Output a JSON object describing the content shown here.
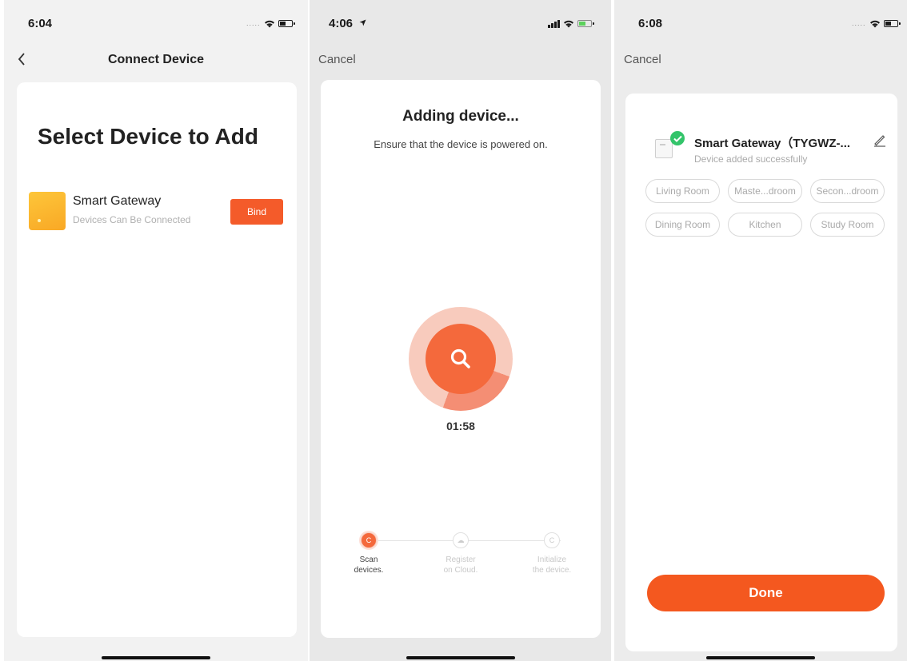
{
  "screens": {
    "select": {
      "status_time": "6:04",
      "status_dots": ".....",
      "nav_title": "Connect Device",
      "heading": "Select Device to Add",
      "device_name": "Smart Gateway",
      "device_status": "Devices Can Be Connected",
      "bind_label": "Bind"
    },
    "adding": {
      "status_time": "4:06",
      "cancel_label": "Cancel",
      "title": "Adding device...",
      "subtitle": "Ensure that the device is powered on.",
      "timer": "01:58",
      "steps": [
        {
          "label": "Scan\ndevices.",
          "active": true
        },
        {
          "label": "Register\non Cloud.",
          "active": false
        },
        {
          "label": "Initialize\nthe device.",
          "active": false
        }
      ]
    },
    "done": {
      "status_time": "6:08",
      "status_dots": ".....",
      "cancel_label": "Cancel",
      "device_name": "Smart Gateway（TYGWZ-...",
      "device_status": "Device added successfully",
      "rooms": [
        "Living Room",
        "Maste...droom",
        "Secon...droom",
        "Dining Room",
        "Kitchen",
        "Study Room"
      ],
      "done_label": "Done"
    }
  },
  "colors": {
    "accent": "#f4581f",
    "success": "#33c46a"
  },
  "icons": [
    "back-chevron-icon",
    "wifi-icon",
    "battery-icon",
    "location-arrow-icon",
    "signal-icon",
    "search-icon",
    "check-icon",
    "edit-pencil-icon",
    "cloud-icon"
  ]
}
